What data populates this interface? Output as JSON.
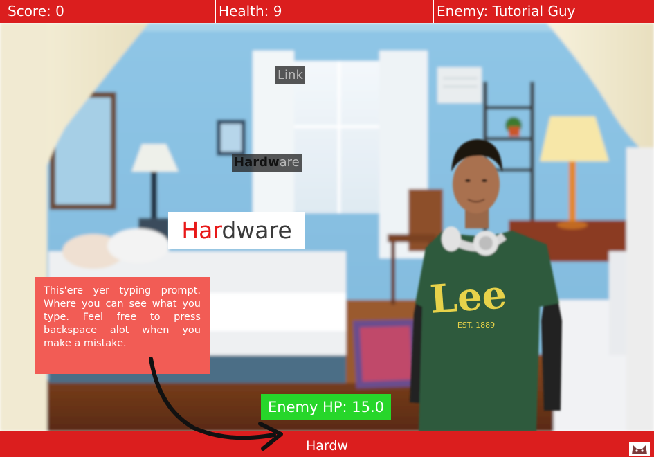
{
  "hud": {
    "score": "Score: 0",
    "health": "Health: 9",
    "enemy": "Enemy: Tutorial Guy"
  },
  "words": [
    {
      "typed": "",
      "rest": "Link"
    },
    {
      "typed": "Hardw",
      "rest": "are"
    }
  ],
  "active_word": {
    "typed": "Har",
    "rest": "dware"
  },
  "tutorial": {
    "text": "This'ere yer typing prompt. Where you can see what you type. Feel free to press backspace alot when you make a mistake."
  },
  "enemy_hp": "Enemy HP: 15.0",
  "typing_input": "Hardw",
  "enemy": {
    "shirt_text": "Lee",
    "shirt_subtext": "EST. 1889"
  },
  "colors": {
    "hud_red": "#db1e1e",
    "hp_green": "#27d62a",
    "tutorial_red": "#f25c55",
    "typed_red": "#e81818"
  },
  "icons": {
    "corner": "cat-face-icon",
    "arrow": "curved-arrow-icon"
  }
}
